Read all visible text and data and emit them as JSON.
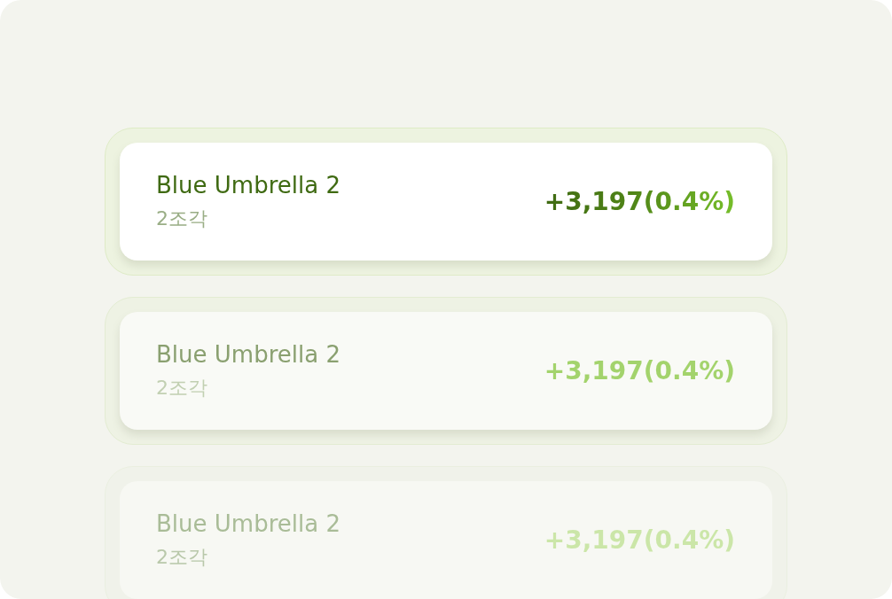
{
  "items": [
    {
      "title": "Blue Umbrella 2",
      "subtitle": "2조각",
      "change": "+3,197(0.4%)",
      "kind": "highlighted"
    },
    {
      "title": "Blue Umbrella 2",
      "subtitle": "2조각",
      "change": "+3,197(0.4%)",
      "kind": "dim"
    },
    {
      "title": "Blue Umbrella 2",
      "subtitle": "2조각",
      "change": "+3,197(0.4%)",
      "kind": "faint"
    }
  ]
}
